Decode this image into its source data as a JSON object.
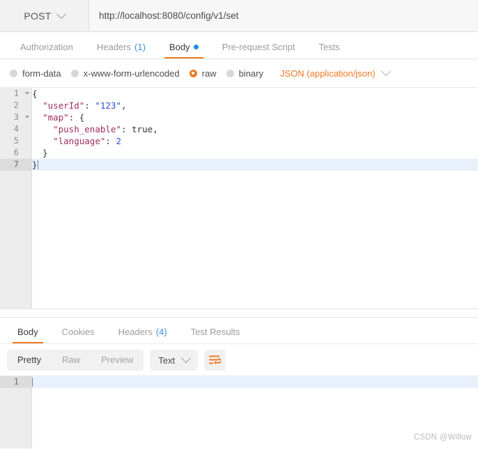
{
  "request_bar": {
    "method": "POST",
    "method_icon": "chevron-down-icon",
    "url": "http://localhost:8080/config/v1/set"
  },
  "request_tabs": [
    {
      "label": "Authorization",
      "active": false,
      "count": "",
      "dot": false
    },
    {
      "label": "Headers",
      "active": false,
      "count": "(1)",
      "dot": false
    },
    {
      "label": "Body",
      "active": true,
      "count": "",
      "dot": true
    },
    {
      "label": "Pre-request Script",
      "active": false,
      "count": "",
      "dot": false
    },
    {
      "label": "Tests",
      "active": false,
      "count": "",
      "dot": false
    }
  ],
  "body_types": [
    {
      "label": "form-data",
      "selected": false
    },
    {
      "label": "x-www-form-urlencoded",
      "selected": false
    },
    {
      "label": "raw",
      "selected": true
    },
    {
      "label": "binary",
      "selected": false
    }
  ],
  "content_type": {
    "label": "JSON (application/json)",
    "icon": "chevron-down-icon"
  },
  "request_editor": {
    "lines": [
      {
        "number": "1",
        "fold": true,
        "active": false,
        "tokens": [
          {
            "t": "{",
            "c": "punct"
          }
        ]
      },
      {
        "number": "2",
        "fold": false,
        "active": false,
        "tokens": [
          {
            "t": "  ",
            "c": "punct"
          },
          {
            "t": "\"userId\"",
            "c": "key"
          },
          {
            "t": ": ",
            "c": "punct"
          },
          {
            "t": "\"123\"",
            "c": "str"
          },
          {
            "t": ",",
            "c": "punct"
          }
        ]
      },
      {
        "number": "3",
        "fold": true,
        "active": false,
        "tokens": [
          {
            "t": "  ",
            "c": "punct"
          },
          {
            "t": "\"map\"",
            "c": "key"
          },
          {
            "t": ": {",
            "c": "punct"
          }
        ]
      },
      {
        "number": "4",
        "fold": false,
        "active": false,
        "tokens": [
          {
            "t": "    ",
            "c": "punct"
          },
          {
            "t": "\"push_enable\"",
            "c": "key"
          },
          {
            "t": ": ",
            "c": "punct"
          },
          {
            "t": "true",
            "c": "bool"
          },
          {
            "t": ",",
            "c": "punct"
          }
        ]
      },
      {
        "number": "5",
        "fold": false,
        "active": false,
        "tokens": [
          {
            "t": "    ",
            "c": "punct"
          },
          {
            "t": "\"language\"",
            "c": "key"
          },
          {
            "t": ": ",
            "c": "punct"
          },
          {
            "t": "2",
            "c": "num"
          }
        ]
      },
      {
        "number": "6",
        "fold": false,
        "active": false,
        "tokens": [
          {
            "t": "  }",
            "c": "punct"
          }
        ]
      },
      {
        "number": "7",
        "fold": false,
        "active": true,
        "caret": true,
        "tokens": [
          {
            "t": "}",
            "c": "punct"
          }
        ]
      }
    ]
  },
  "response_tabs": [
    {
      "label": "Body",
      "active": true,
      "count": ""
    },
    {
      "label": "Cookies",
      "active": false,
      "count": ""
    },
    {
      "label": "Headers",
      "active": false,
      "count": "(4)"
    },
    {
      "label": "Test Results",
      "active": false,
      "count": ""
    }
  ],
  "response_toolbar": {
    "view_modes": [
      {
        "label": "Pretty",
        "active": true
      },
      {
        "label": "Raw",
        "active": false
      },
      {
        "label": "Preview",
        "active": false
      }
    ],
    "format": {
      "label": "Text",
      "icon": "chevron-down-icon"
    },
    "wrap_button": {
      "icon": "word-wrap-icon"
    }
  },
  "response_editor": {
    "lines": [
      {
        "number": "1",
        "active": true,
        "content": ""
      }
    ]
  },
  "watermark": "CSDN @Willow",
  "colors": {
    "accent": "#ef7822",
    "link": "#3b8ede",
    "dot": "#1a8fe8",
    "active_line": "#e8f0fb",
    "gutter": "#ececec"
  }
}
